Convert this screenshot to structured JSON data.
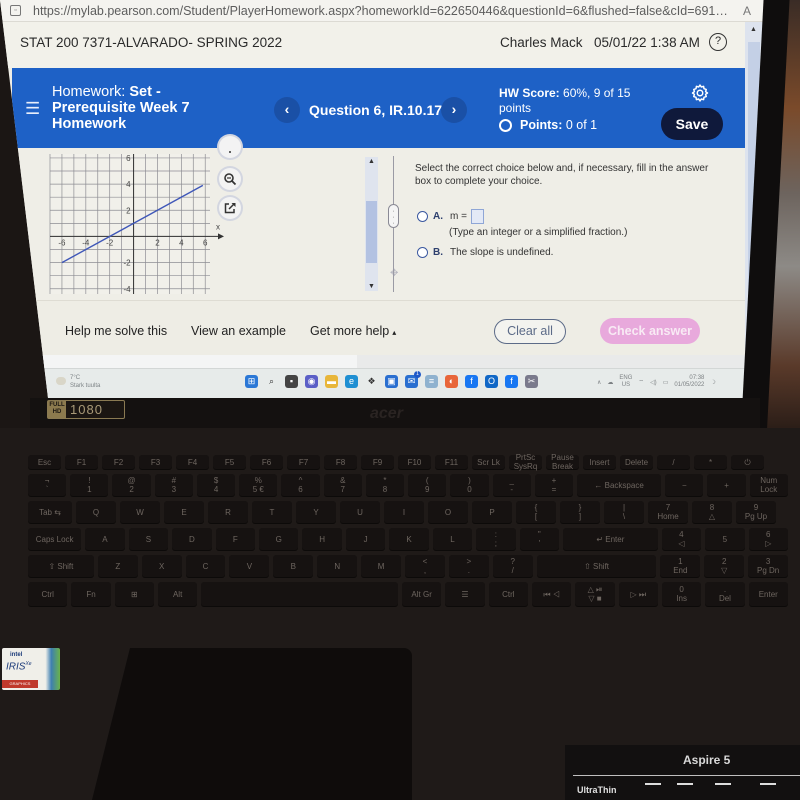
{
  "browser": {
    "url": "https://mylab.pearson.com/Student/PlayerHomework.aspx?homeworkId=622650446&questionId=6&flushed=false&cId=6910725&c...",
    "read_aloud_label": "A"
  },
  "course_bar": {
    "course_title": "STAT 200 7371-ALVARADO- SPRING 2022",
    "user_name": "Charles Mack",
    "datetime": "05/01/22 1:38 AM",
    "help_label": "?"
  },
  "header": {
    "homework_prefix": "Homework:",
    "homework_title_line1": "Set -",
    "homework_title_line2": "Prerequisite Week 7",
    "homework_title_line3": "Homework",
    "prev_label": "‹",
    "question_label": "Question 6, IR.10.17",
    "next_label": "›",
    "hw_score_label": "HW Score:",
    "hw_score_value": "60%, 9 of 15",
    "hw_score_unit": "points",
    "points_label": "Points:",
    "points_value": "0 of 1",
    "save_label": "Save"
  },
  "question": {
    "graph": {
      "x_axis_label": "x",
      "x_range": [
        -7,
        6.4
      ],
      "y_range": [
        -4.4,
        6.3
      ],
      "x_ticks": [
        -6,
        -4,
        -2,
        2,
        4,
        6
      ],
      "y_ticks": [
        -4,
        -2,
        2,
        4,
        6
      ],
      "line": {
        "from": [
          -6,
          -2
        ],
        "to": [
          5.8,
          3.9
        ],
        "color": "#3f57b8"
      }
    },
    "tools": [
      "partial-tool",
      "zoom-in",
      "open-in-new-window"
    ],
    "instruction": "Select the correct choice below and, if necessary, fill in the answer box to complete your choice.",
    "choices": [
      {
        "letter": "A.",
        "text": "m =",
        "input_value": "",
        "hint": "(Type an integer or a simplified fraction.)",
        "selected": false
      },
      {
        "letter": "B.",
        "text": "The slope is undefined.",
        "selected": false
      }
    ]
  },
  "footer": {
    "help_me_solve": "Help me solve this",
    "view_example": "View an example",
    "get_more_help": "Get more help",
    "get_more_help_caret": "▴",
    "clear_all": "Clear all",
    "check_answer": "Check answer"
  },
  "taskbar": {
    "weather_temp": "7°C",
    "weather_text": "Stark tuulta",
    "apps": [
      "windows-start",
      "search",
      "task-view",
      "chat",
      "file-explorer",
      "edge",
      "dropbox",
      "store",
      "mail",
      "app-bar",
      "firefox",
      "facebook",
      "outlook",
      "facebook",
      "snipping-tool"
    ],
    "mail_badge": "1",
    "tray": {
      "lang": "ENG",
      "region": "US",
      "time": "07:38",
      "date": "01/05/2022"
    }
  },
  "laptop": {
    "display_badge_top": "FULL HD",
    "display_badge_value": "1080",
    "brand": "acer",
    "intel_line1": "intel",
    "intel_line2": "IRIS",
    "intel_line2_sup": "Xe",
    "intel_line3": "GRAPHICS",
    "model": "Aspire 5",
    "feature_label": "UltraThin",
    "keyboard_rows": [
      [
        "Esc",
        "F1",
        "F2",
        "F3",
        "F4",
        "F5",
        "F6",
        "F7",
        "F8",
        "F9",
        "F10",
        "F11",
        "Scr Lk",
        "PrtSc\nSysRq",
        "Pause\nBreak",
        "Insert",
        "Delete",
        "/",
        "*",
        "⏻"
      ],
      [
        "¬\n`",
        "!\n1",
        "@\n2",
        "#\n3",
        "$\n4",
        "%\n5 €",
        "^\n6",
        "&\n7",
        "*\n8",
        "(\n9",
        ")\n0",
        "_\n-",
        "+\n=",
        "← Backspace",
        "−",
        "+",
        "Num\nLock"
      ],
      [
        "Tab ⇆",
        "Q",
        "W",
        "E",
        "R",
        "T",
        "Y",
        "U",
        "I",
        "O",
        "P",
        "{\n[",
        "}\n]",
        "|\n\\",
        "7\nHome",
        "8\n△",
        "9\nPg Up"
      ],
      [
        "Caps Lock",
        "A",
        "S",
        "D",
        "F",
        "G",
        "H",
        "J",
        "K",
        "L",
        ":\n;",
        "\"\n'",
        "↵ Enter",
        "4\n◁",
        "5",
        "6\n▷"
      ],
      [
        "⇧ Shift",
        "Z",
        "X",
        "C",
        "V",
        "B",
        "N",
        "M",
        "<\n,",
        ">\n.",
        "?\n/",
        "⇧ Shift",
        "1\nEnd",
        "2\n▽",
        "3\nPg Dn"
      ],
      [
        "Ctrl",
        "Fn",
        "⊞",
        "Alt",
        "",
        "Alt Gr",
        "☰",
        "Ctrl",
        "⏮ ◁",
        "△ ⏯\n▽ ■",
        "▷ ⏭",
        "0\nIns",
        ".\nDel",
        "Enter"
      ]
    ]
  }
}
